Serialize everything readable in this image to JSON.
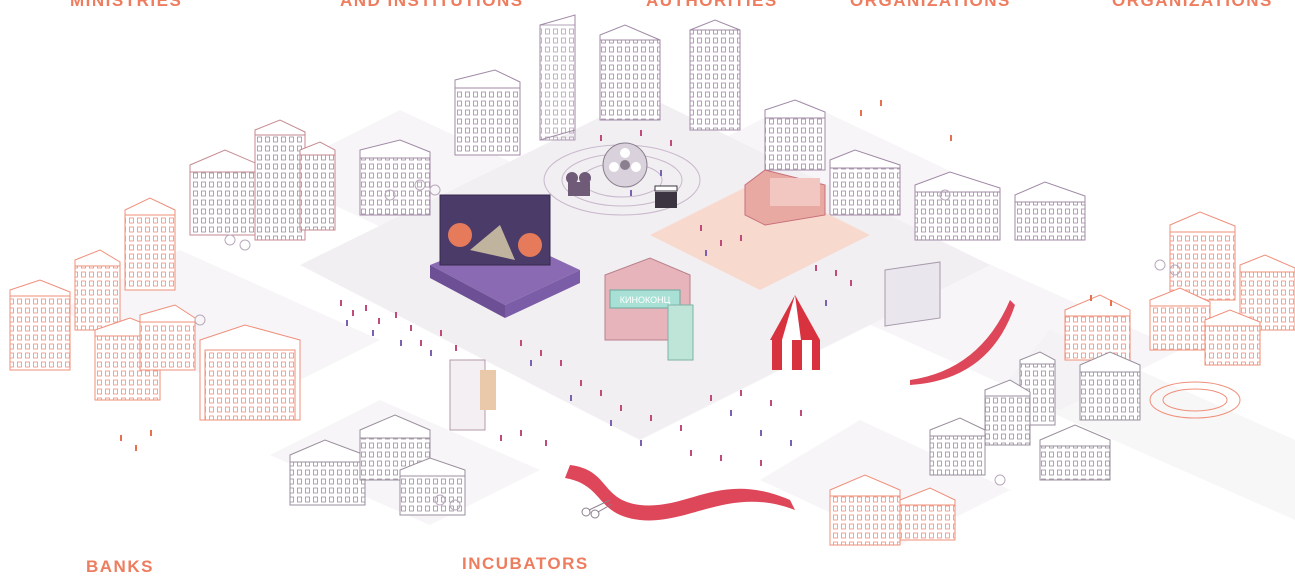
{
  "labels": {
    "ministries": "MINISTRIES",
    "education": "AND INSTITUTIONS",
    "authorities": "AUTHORITIES",
    "organizations_1": "ORGANIZATIONS",
    "organizations_2": "ORGANIZATIONS",
    "banks": "BANKS",
    "incubators": "INCUBATORS"
  },
  "cinema_sign": "КИНОКОНЦ",
  "colors": {
    "label": "#ee7c5e",
    "salmon_outline": "#ef8f7a",
    "purple_outline": "#a08aa6",
    "stage_purple": "#8a6bb3",
    "plaza_pink": "#f7d9ce",
    "tent_red": "#d8323f",
    "ribbon_red": "#de4659",
    "cinema_teal": "#a9e0d6",
    "cinema_pink": "#e8b4bc",
    "ground_gray": "#f2eff2"
  },
  "icons": [
    "film-reel-icon",
    "film-camera-icon",
    "clapperboard-icon",
    "scissors-icon"
  ]
}
